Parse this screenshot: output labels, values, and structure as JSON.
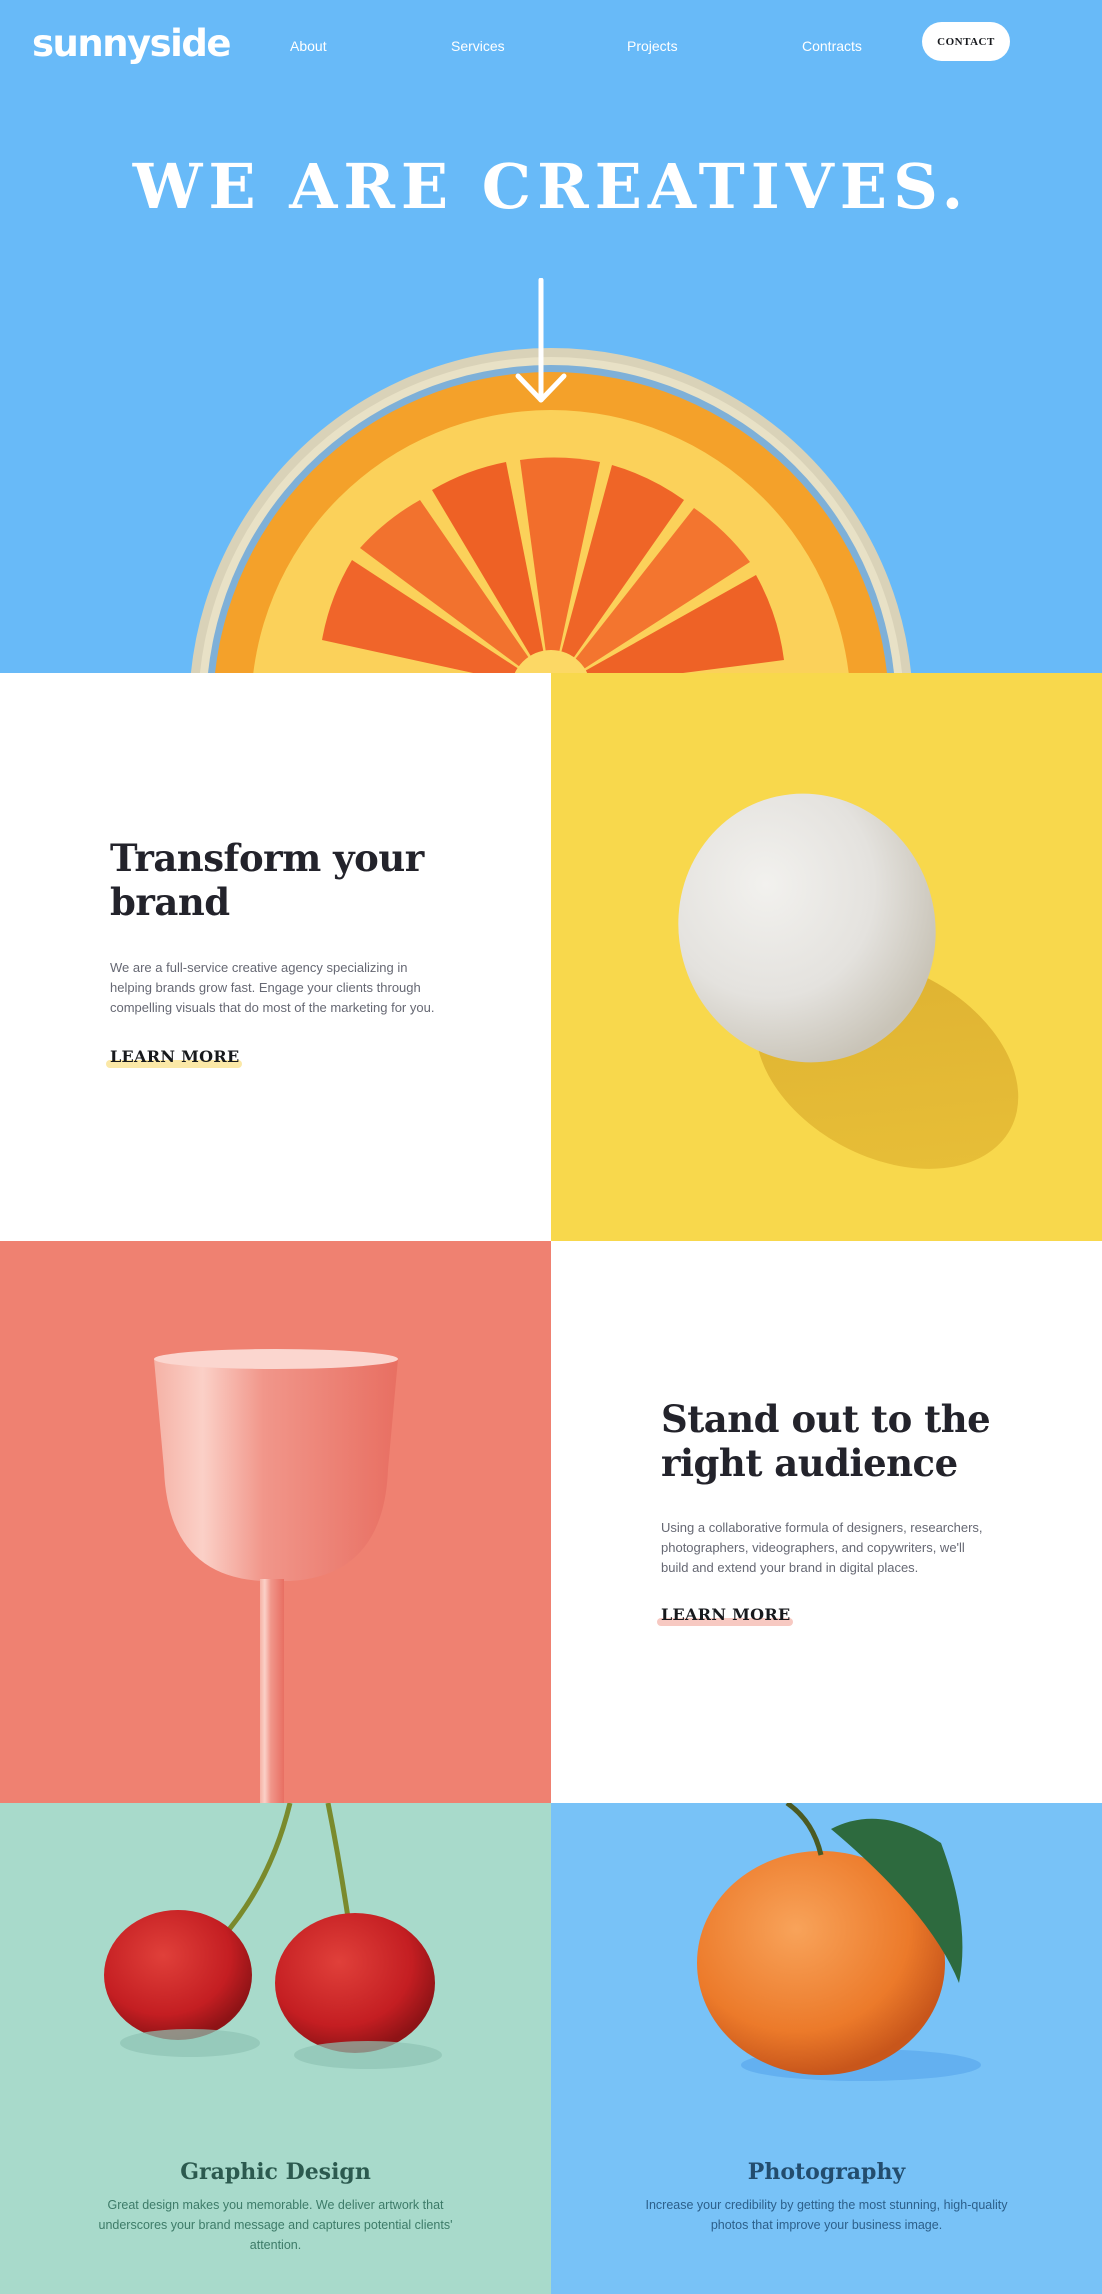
{
  "header": {
    "logo": "sunnyside",
    "nav": [
      {
        "label": "About"
      },
      {
        "label": "Services"
      },
      {
        "label": "Projects"
      },
      {
        "label": "Contracts"
      }
    ],
    "contact_label": "CONTACT"
  },
  "hero": {
    "title": "WE ARE CREATIVES.",
    "icons": {
      "scroll": "arrow-down-icon",
      "image": "orange-slice-image"
    },
    "colors": {
      "background": "#68baf8",
      "orange": "#f26b2a",
      "rind": "#f9c02e"
    }
  },
  "transform": {
    "heading_line1": "Transform your",
    "heading_line2": "brand",
    "body_line1": "We are a full-service creative agency specializing in",
    "body_line2": "helping brands grow fast. Engage your clients through",
    "body_line3": "compelling visuals that do most of the marketing for you.",
    "link": "LEARN MORE",
    "accent_color": "#fbe8a7",
    "image": "egg-image",
    "image_bg": "#f8d84c"
  },
  "standout": {
    "heading_line1": "Stand out to the",
    "heading_line2": "right audience",
    "body_line1": "Using a collaborative formula of designers, researchers,",
    "body_line2": "photographers, videographers, and copywriters, we'll",
    "body_line3": "build and extend your brand in digital places.",
    "link": "LEARN MORE",
    "accent_color": "#f7c9c2",
    "image": "glass-image",
    "image_bg": "#ef8171"
  },
  "services": [
    {
      "title": "Graphic Design",
      "desc_line1": "Great design makes you memorable. We deliver artwork that",
      "desc_line2": "underscores your brand message and captures potential clients'",
      "desc_line3": "attention.",
      "image": "cherries-image",
      "bg": "#a8dacb",
      "title_color": "#2c5a4f",
      "text_color": "#3d7b68"
    },
    {
      "title": "Photography",
      "desc_line1": "Increase your credibility by getting the most stunning, high-quality",
      "desc_line2": "photos that improve your business image.",
      "image": "orange-image",
      "bg": "#78c2f7",
      "title_color": "#234d6e",
      "text_color": "#2c5f8a"
    }
  ]
}
